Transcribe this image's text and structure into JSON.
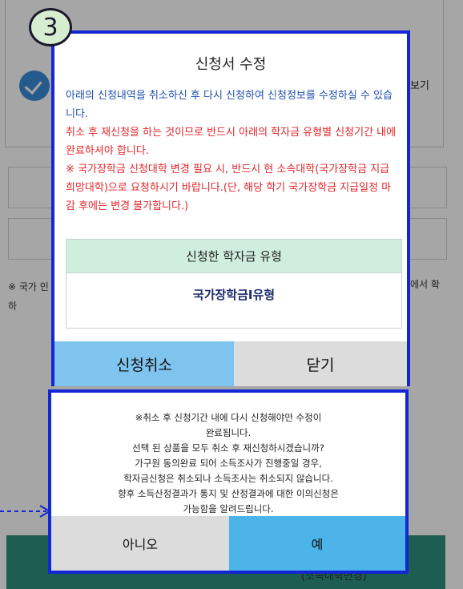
{
  "step_number": "3",
  "background": {
    "view_label": "보기",
    "note_left": "※ 국가 인하",
    "note_right": "에서 확",
    "bottom_label": "(소속대학변경)"
  },
  "dialog1": {
    "title": "신청서 수정",
    "notice_blue": "아래의 신청내역을 취소하신 후 다시 신청하여 신청정보를 수정하실 수 있습니다.",
    "notice_red_1": "취소 후 재신청을 하는 것이므로 반드시 아래의 학자금 유형별 신청기간 내에 완료하셔야 합니다.",
    "notice_red_2": "※ 국가장학금 신청대학 변경 필요 시, 반드시 현 소속대학(국가장학금 지급 희망대학)으로 요청하시기 바랍니다.(단, 해당 학기 국가장학금 지급일정 마감 후에는 변경 불가합니다.)",
    "table_header": "신청한 학자금 유형",
    "table_value": "국가장학금I유형",
    "cancel_button": "신청취소",
    "close_button": "닫기"
  },
  "dialog2": {
    "message_lines": [
      "※취소 후 신청기간 내에 다시 신청해야만 수정이",
      "완료됩니다.",
      "선택 된 상품을 모두 취소 후 재신청하시겠습니까?",
      "가구원 동의완료 되어 소득조사가 진행중일 경우,",
      "학자금신청은 취소되나 소득조사는 취소되지 않습니다.",
      "향후 소득산정결과가 통지 및 산정결과에 대한 이의신청은",
      "가능함을 알려드립니다."
    ],
    "no_button": "아니오",
    "yes_button": "예"
  },
  "colors": {
    "highlight_border": "#1226d6",
    "cancel_button_bg": "#7fc4ef",
    "yes_button_bg": "#4db4ea",
    "table_header_bg": "#cfeedd",
    "notice_blue": "#1e4fb0",
    "notice_red": "#e3262b"
  }
}
